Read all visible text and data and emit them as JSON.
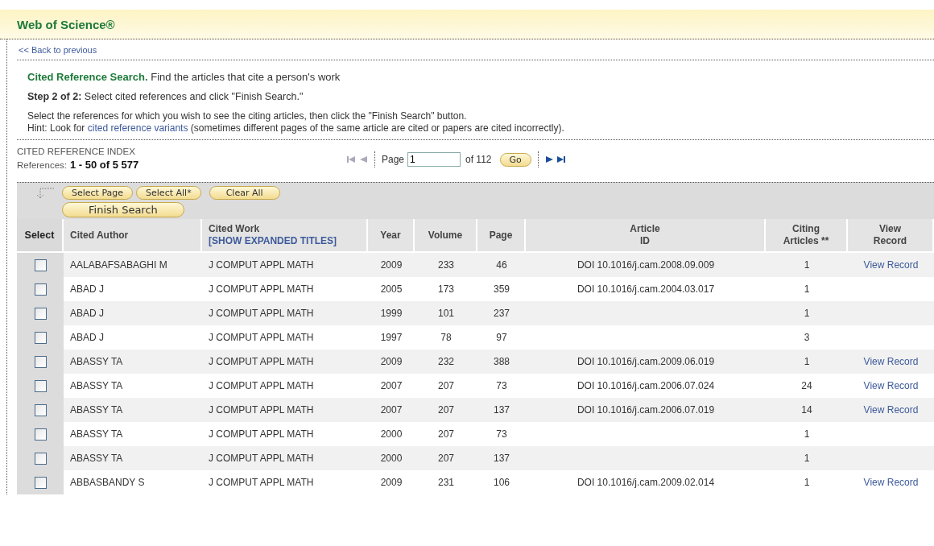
{
  "header": {
    "title": "Web of Science®"
  },
  "back_link": "<< Back to previous",
  "intro": {
    "heading": "Cited Reference Search.",
    "heading_text": "Find the articles that cite a person's work",
    "step": "**Step 2 of 2:** Select cited references and click \"Finish Search.\"",
    "instructions": "Select the references for which you wish to see the citing articles, then click the \"Finish Search\" button.",
    "hint_before": "Hint: Look for",
    "hint_link": "cited reference variants",
    "hint_after": "(sometimes different pages of the same article are cited or papers are cited incorrectly)."
  },
  "index": {
    "title": "CITED REFERENCE INDEX",
    "references_label": "References:",
    "references_range": "1 - 50 of  5 577"
  },
  "pager": {
    "page_label": "Page",
    "page_value": "1",
    "of_label": "of 112",
    "go": "Go"
  },
  "toolbar": {
    "buttons": [
      "Select Page",
      "Select All*",
      "Clear All"
    ],
    "finish": "Finish Search"
  },
  "table": {
    "columns": [
      "Select",
      "Cited Author",
      "Cited Work",
      "Year",
      "Volume",
      "Page",
      "Article\nID",
      "Citing\nArticles **",
      "View\nRecord"
    ],
    "expand_link": "[SHOW EXPANDED TITLES]",
    "rows": [
      {
        "checked": false,
        "author": "AALABAFSABAGHI M",
        "work": "J COMPUT APPL MATH",
        "year": "2009",
        "volume": "233",
        "page": "46",
        "article_id": "DOI 10.1016/j.cam.2008.09.009",
        "citing": "1",
        "view": "View Record"
      },
      {
        "checked": false,
        "author": "ABAD J",
        "work": "J COMPUT APPL MATH",
        "year": "2005",
        "volume": "173",
        "page": "359",
        "article_id": "DOI 10.1016/j.cam.2004.03.017",
        "citing": "1"
      },
      {
        "checked": false,
        "author": "ABAD J",
        "work": "J COMPUT APPL MATH",
        "year": "1999",
        "volume": "101",
        "page": "237",
        "citing": "1"
      },
      {
        "checked": false,
        "author": "ABAD J",
        "work": "J COMPUT APPL MATH",
        "year": "1997",
        "volume": "78",
        "page": "97",
        "citing": "3"
      },
      {
        "checked": false,
        "author": "ABASSY TA",
        "work": "J COMPUT APPL MATH",
        "year": "2009",
        "volume": "232",
        "page": "388",
        "article_id": "DOI 10.1016/j.cam.2009.06.019",
        "citing": "1",
        "view": "View Record"
      },
      {
        "checked": false,
        "author": "ABASSY TA",
        "work": "J COMPUT APPL MATH",
        "year": "2007",
        "volume": "207",
        "page": "73",
        "article_id": "DOI 10.1016/j.cam.2006.07.024",
        "citing": "24",
        "view": "View Record"
      },
      {
        "checked": false,
        "author": "ABASSY TA",
        "work": "J COMPUT APPL MATH",
        "year": "2007",
        "volume": "207",
        "page": "137",
        "article_id": "DOI 10.1016/j.cam.2006.07.019",
        "citing": "14",
        "view": "View Record"
      },
      {
        "checked": false,
        "author": "ABASSY TA",
        "work": "J COMPUT APPL MATH",
        "year": "2000",
        "volume": "207",
        "page": "73",
        "citing": "1"
      },
      {
        "checked": false,
        "author": "ABASSY TA",
        "work": "J COMPUT APPL MATH",
        "year": "2000",
        "volume": "207",
        "page": "137",
        "citing": "1"
      },
      {
        "checked": false,
        "author": "ABBASBANDY S",
        "work": "J COMPUT APPL MATH",
        "year": "2009",
        "volume": "231",
        "page": "106",
        "article_id": "DOI 10.1016/j.cam.2009.02.014",
        "citing": "1",
        "view": "View Record"
      }
    ]
  }
}
